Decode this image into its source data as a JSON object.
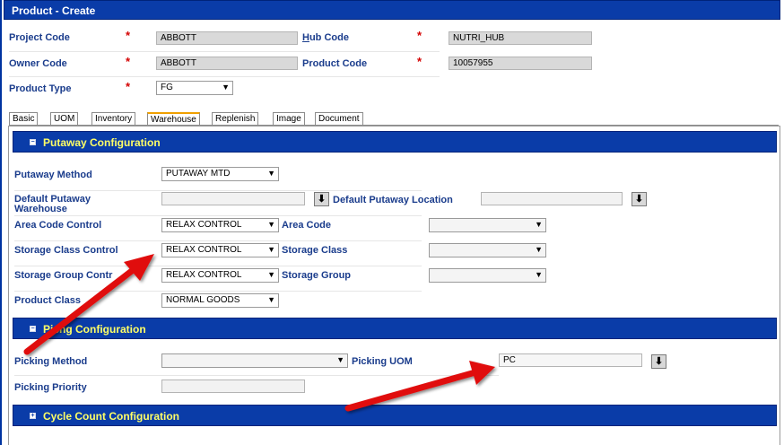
{
  "window": {
    "title": "Product -  Create"
  },
  "header_fields": {
    "project_code": {
      "label": "Project Code",
      "value": "ABBOTT"
    },
    "hub_code": {
      "label_prefix": "H",
      "label_rest": "ub Code",
      "value": "NUTRI_HUB"
    },
    "owner_code": {
      "label": "Owner Code",
      "value": "ABBOTT"
    },
    "product_code": {
      "label": "Product Code",
      "value": "10057955"
    },
    "product_type": {
      "label": "Product Type",
      "value": "FG"
    },
    "required_mark": "*"
  },
  "tabs": [
    {
      "label": "Basic"
    },
    {
      "label": "UOM"
    },
    {
      "label": "Inventory"
    },
    {
      "label": "Warehouse",
      "active": true
    },
    {
      "label": "Replenish"
    },
    {
      "label": "Image"
    },
    {
      "label": "Document"
    }
  ],
  "putaway": {
    "title": "Putaway Configuration",
    "toggle": "−",
    "method": {
      "label": "Putaway Method",
      "value": "PUTAWAY MTD"
    },
    "default_warehouse": {
      "label_line1": "Default Putaway",
      "label_line2": "Warehouse",
      "value": ""
    },
    "default_location": {
      "label": "Default Putaway Location",
      "value": ""
    },
    "area_code_control": {
      "label": "Area Code Control",
      "value": "RELAX CONTROL"
    },
    "area_code": {
      "label": "Area Code",
      "value": ""
    },
    "storage_class_control": {
      "label": "Storage Class Control",
      "value": "RELAX CONTROL"
    },
    "storage_class": {
      "label": "Storage Class",
      "value": ""
    },
    "storage_group_control": {
      "label": "Storage Group Contr",
      "value": "RELAX CONTROL"
    },
    "storage_group": {
      "label": "Storage Group",
      "value": ""
    },
    "product_class": {
      "label": "Product Class",
      "value": "NORMAL GOODS"
    }
  },
  "picking": {
    "title": "Pic",
    "title_rest": "ng Configuration",
    "toggle": "−",
    "method": {
      "label": "Picking Method",
      "value": ""
    },
    "uom": {
      "label": "Picking UOM",
      "value": "PC"
    },
    "priority": {
      "label": "Picking Priority",
      "value": ""
    }
  },
  "cycle_count": {
    "title": "Cycle Count Configuration",
    "toggle": "+"
  },
  "icons": {
    "dropdown": "▼",
    "lookup": "⬇"
  },
  "colors": {
    "header_blue": "#0a3ca8",
    "section_title": "#ffff66",
    "label_blue": "#1a3c8c",
    "required_red": "#d40000",
    "annotation_arrow": "#e01010"
  }
}
